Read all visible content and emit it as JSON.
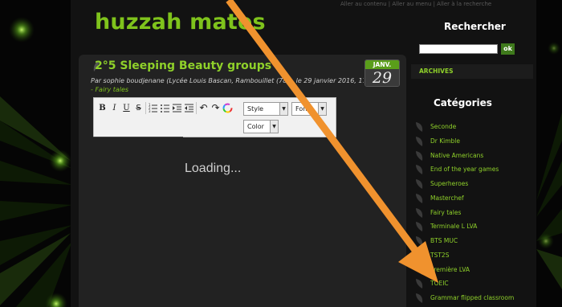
{
  "site": {
    "title": "huzzah mates",
    "skip_links": "Aller au contenu | Aller au menu | Aller à la recherche"
  },
  "post": {
    "title": "2°5 Sleeping Beauty groups",
    "meta": "Par sophie boudjenane (Lycée Louis Bascan, Rambouillet (78)), le 29 janvier 2016, 17:29",
    "category_prefix": "- ",
    "category": "Fairy tales",
    "date_month": "JANV.",
    "date_day": "29"
  },
  "editor": {
    "bold": "B",
    "italic": "I",
    "underline": "U",
    "strike": "S",
    "style_label": "Style",
    "font_label": "Font",
    "color_label": "Color",
    "loading": "Loading..."
  },
  "sidebar": {
    "search_title": "Rechercher",
    "search_button": "ok",
    "archives_label": "ARCHIVES",
    "categories_title": "Catégories",
    "categories": [
      {
        "label": "Seconde"
      },
      {
        "label": "Dr Kimble"
      },
      {
        "label": "Native Americans"
      },
      {
        "label": "End of the year games"
      },
      {
        "label": "Superheroes"
      },
      {
        "label": "Masterchef"
      },
      {
        "label": "Fairy tales"
      },
      {
        "label": "Terminale L LVA"
      },
      {
        "label": "BTS MUC"
      },
      {
        "label": "TST2S"
      },
      {
        "label": "Première LVA"
      },
      {
        "label": "TOEIC"
      },
      {
        "label": "Grammar flipped classroom"
      }
    ]
  },
  "colors": {
    "brand_green": "#7fc31c",
    "annotation_orange": "#f0922e"
  },
  "icons": [
    "leaf-icon",
    "orange-arrow-annotation",
    "chevron-down-icon",
    "undo-icon",
    "redo-icon",
    "color-wheel-icon"
  ]
}
